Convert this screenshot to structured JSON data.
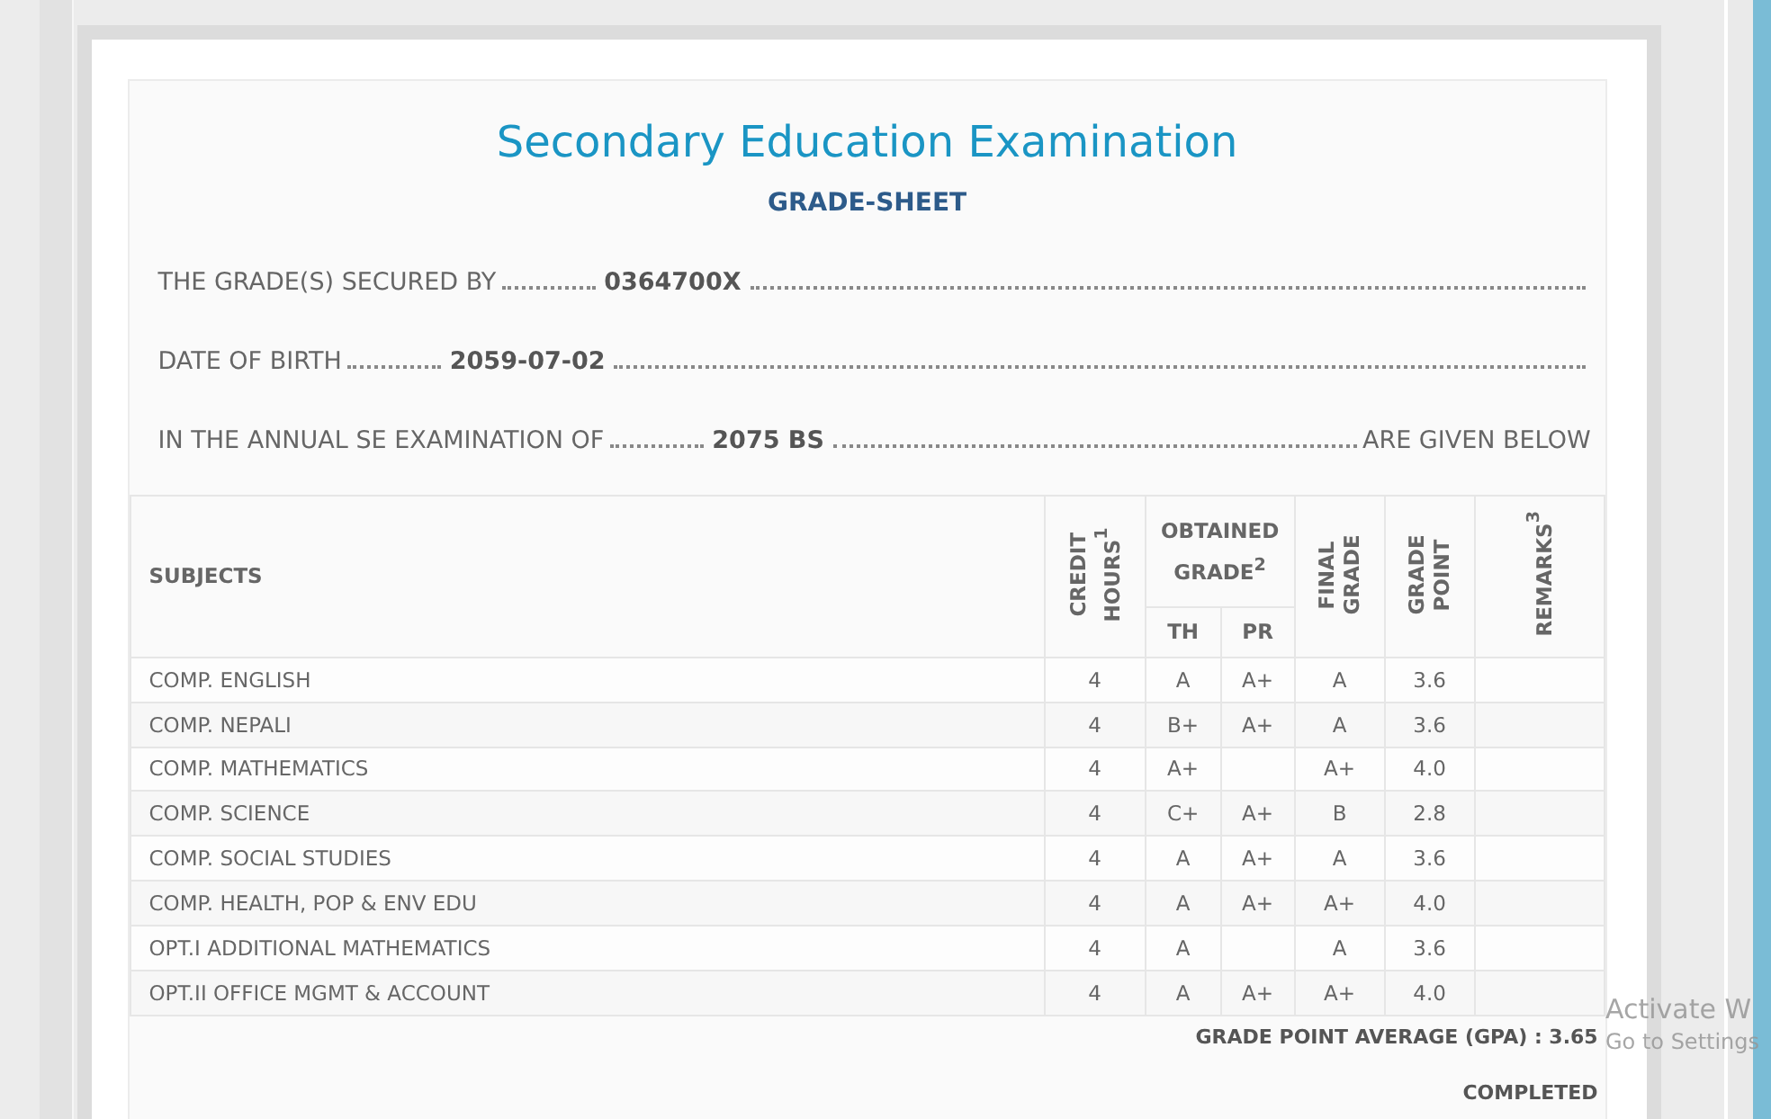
{
  "title": "Secondary Education Examination",
  "subtitle": "GRADE-SHEET",
  "statements": [
    {
      "label": "THE GRADE(S) SECURED BY",
      "value": "0364700X"
    },
    {
      "label": "DATE OF BIRTH",
      "value": "2059-07-02"
    },
    {
      "label": "IN THE ANNUAL SE EXAMINATION OF",
      "value": "2075 BS",
      "suffix": "ARE GIVEN BELOW"
    }
  ],
  "table": {
    "columns": [
      {
        "kind": "plain",
        "label": "SUBJECTS"
      },
      {
        "kind": "rotated",
        "label": "CREDIT HOURS$^{1}$"
      },
      {
        "kind": "group",
        "label": "OBTAINED GRADE$^{2}$",
        "children": [
          "TH",
          "PR"
        ]
      },
      {
        "kind": "rotated",
        "label": "FINAL GRADE"
      },
      {
        "kind": "rotated",
        "label": "GRADE POINT"
      },
      {
        "kind": "rotated",
        "label": "REMARKS$^{3}$"
      }
    ],
    "rows": [
      {
        "subject": "COMP. ENGLISH",
        "credit": "4",
        "th": "A",
        "pr": "A+",
        "final": "A",
        "point": "3.6"
      },
      {
        "subject": "COMP. NEPALI",
        "credit": "4",
        "th": "B+",
        "pr": "A+",
        "final": "A",
        "point": "3.6"
      },
      {
        "subject": "COMP. MATHEMATICS",
        "credit": "4",
        "th": "A+",
        "final": "A+",
        "point": "4.0"
      },
      {
        "subject": "COMP. SCIENCE",
        "credit": "4",
        "th": "C+",
        "pr": "A+",
        "final": "B",
        "point": "2.8"
      },
      {
        "subject": "COMP. SOCIAL STUDIES",
        "credit": "4",
        "th": "A",
        "pr": "A+",
        "final": "A",
        "point": "3.6"
      },
      {
        "subject": "COMP. HEALTH, POP & ENV EDU",
        "credit": "4",
        "th": "A",
        "pr": "A+",
        "final": "A+",
        "point": "4.0"
      },
      {
        "subject": "OPT.I ADDITIONAL MATHEMATICS",
        "credit": "4",
        "th": "A",
        "final": "A",
        "point": "3.6"
      },
      {
        "subject": "OPT.II OFFICE MGMT & ACCOUNT",
        "credit": "4",
        "th": "A",
        "pr": "A+",
        "final": "A+",
        "point": "4.0"
      }
    ]
  },
  "gpa": "GRADE POINT AVERAGE (GPA) : 3.65",
  "result": "COMPLETED",
  "os_notice": {
    "title": "Activate W",
    "subtitle": "Go to Settings"
  }
}
